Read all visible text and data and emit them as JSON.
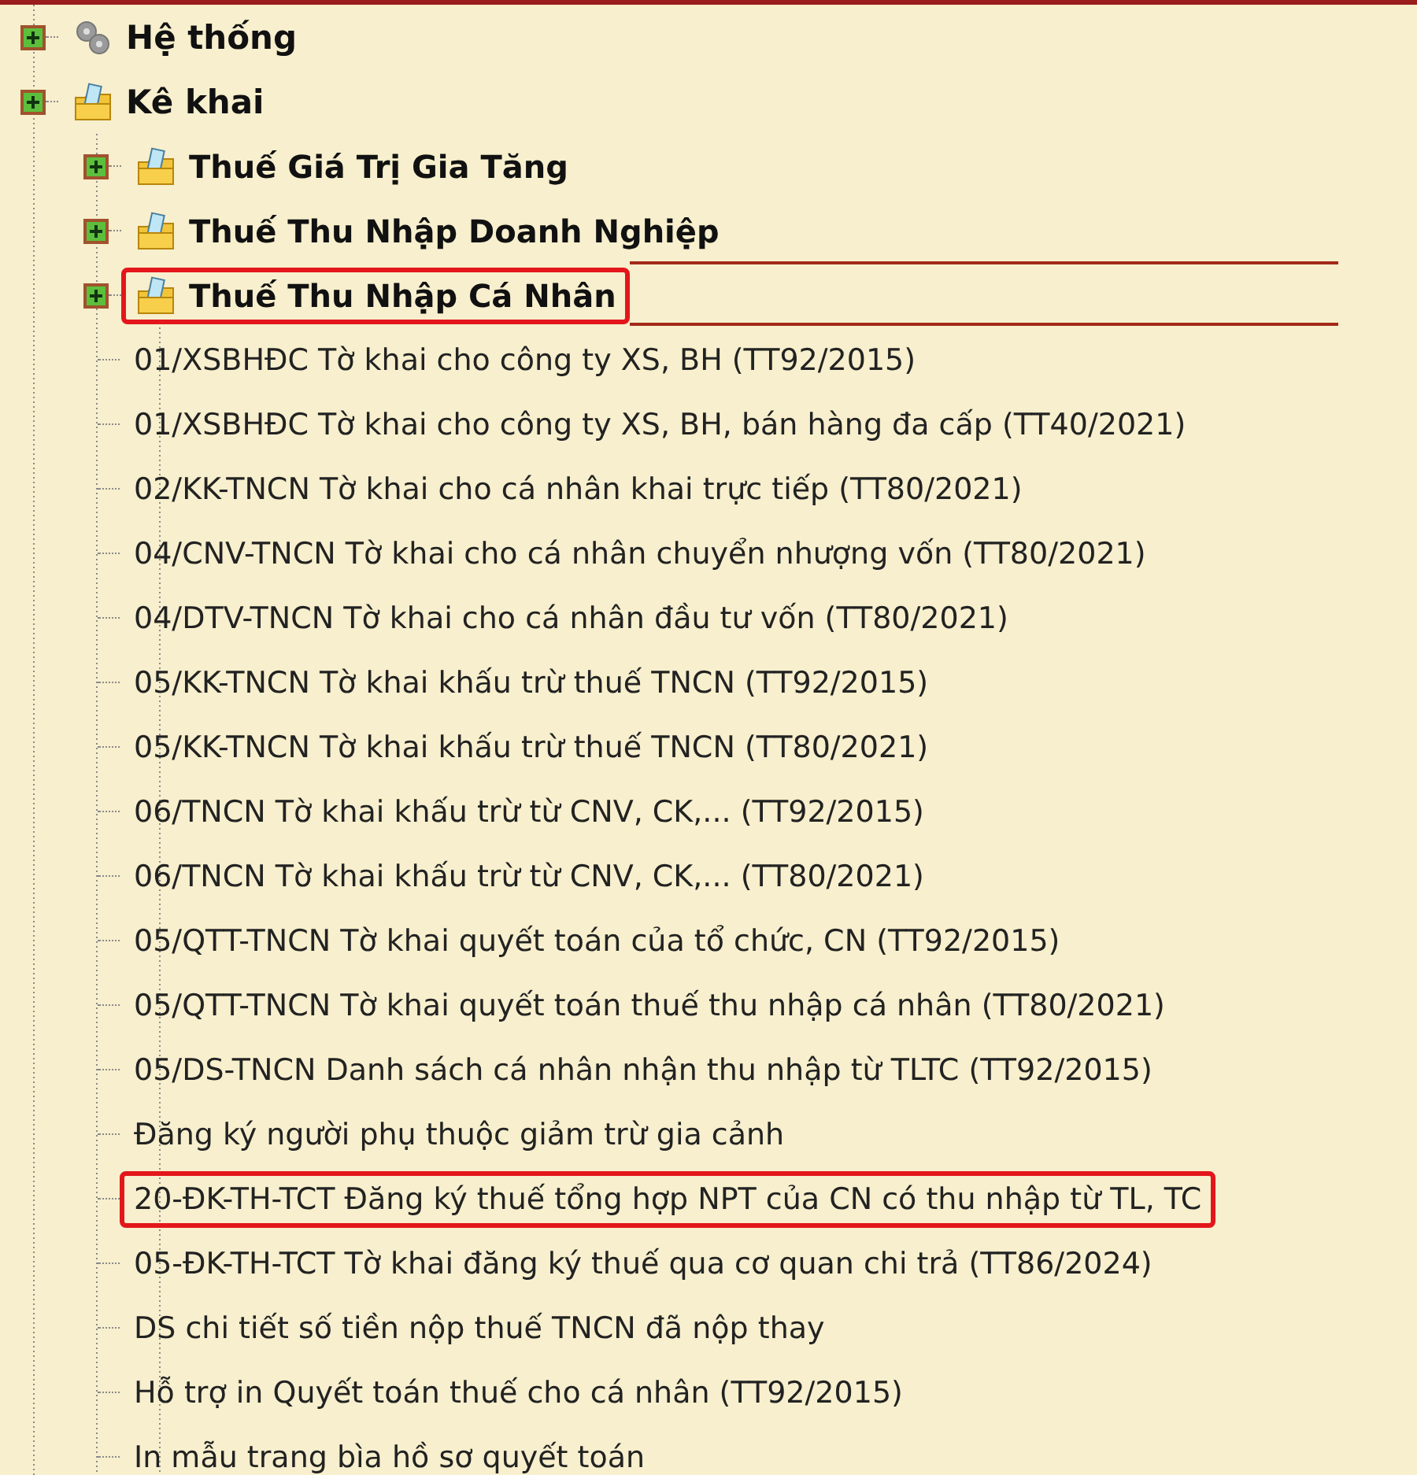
{
  "tree": [
    {
      "label": "Hệ thống",
      "kind": "gear",
      "highlighted": false
    },
    {
      "label": "Kê khai",
      "kind": "folder",
      "highlighted": false,
      "children": [
        {
          "label": "Thuế Giá Trị Gia Tăng",
          "kind": "folder",
          "highlighted": false
        },
        {
          "label": "Thuế Thu Nhập Doanh Nghiệp",
          "kind": "folder",
          "highlighted": false
        },
        {
          "label": "Thuế Thu Nhập Cá Nhân",
          "kind": "folder",
          "highlighted": true,
          "children": [
            {
              "label": "01/XSBHĐC Tờ khai cho công ty XS, BH (TT92/2015)",
              "kind": "document",
              "highlighted": false
            },
            {
              "label": "01/XSBHĐC Tờ khai cho công ty XS, BH, bán hàng đa cấp (TT40/2021)",
              "kind": "document",
              "highlighted": false
            },
            {
              "label": "02/KK-TNCN Tờ khai cho cá nhân khai trực tiếp (TT80/2021)",
              "kind": "document",
              "highlighted": false
            },
            {
              "label": "04/CNV-TNCN Tờ khai cho cá nhân chuyển nhượng vốn (TT80/2021)",
              "kind": "document",
              "highlighted": false
            },
            {
              "label": "04/DTV-TNCN Tờ khai cho cá nhân đầu tư vốn (TT80/2021)",
              "kind": "document",
              "highlighted": false
            },
            {
              "label": "05/KK-TNCN Tờ khai khấu trừ thuế TNCN (TT92/2015)",
              "kind": "document",
              "highlighted": false
            },
            {
              "label": "05/KK-TNCN Tờ khai khấu trừ thuế TNCN (TT80/2021)",
              "kind": "document",
              "highlighted": false
            },
            {
              "label": "06/TNCN Tờ khai khấu trừ từ CNV, CK,... (TT92/2015)",
              "kind": "document",
              "highlighted": false
            },
            {
              "label": "06/TNCN Tờ khai khấu trừ từ CNV, CK,... (TT80/2021)",
              "kind": "document",
              "highlighted": false
            },
            {
              "label": "05/QTT-TNCN Tờ khai quyết toán của tổ chức, CN (TT92/2015)",
              "kind": "document",
              "highlighted": false
            },
            {
              "label": "05/QTT-TNCN Tờ khai quyết toán thuế thu nhập cá nhân (TT80/2021)",
              "kind": "document",
              "highlighted": false
            },
            {
              "label": "05/DS-TNCN Danh sách cá nhân nhận thu nhập từ TLTC (TT92/2015)",
              "kind": "document",
              "highlighted": false
            },
            {
              "label": "Đăng ký người phụ thuộc giảm trừ gia cảnh",
              "kind": "document",
              "highlighted": false
            },
            {
              "label": "20-ĐK-TH-TCT Đăng ký thuế tổng hợp NPT của CN có thu nhập từ TL, TC",
              "kind": "document",
              "highlighted": true
            },
            {
              "label": "05-ĐK-TH-TCT Tờ khai đăng ký thuế qua cơ quan chi trả (TT86/2024)",
              "kind": "document",
              "highlighted": false
            },
            {
              "label": "DS chi tiết số tiền nộp thuế TNCN đã nộp thay",
              "kind": "document",
              "highlighted": false
            },
            {
              "label": "Hỗ trợ in Quyết toán thuế cho cá nhân (TT92/2015)",
              "kind": "document",
              "highlighted": false
            },
            {
              "label": "In mẫu trang bìa hồ sơ quyết toán",
              "kind": "document",
              "highlighted": false
            }
          ]
        }
      ]
    }
  ]
}
